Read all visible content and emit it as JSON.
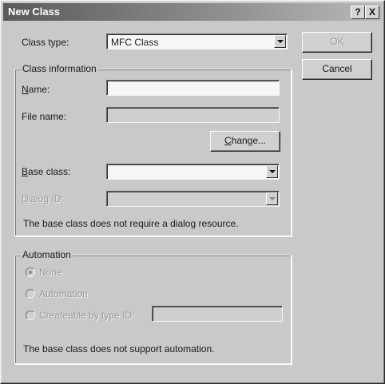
{
  "window": {
    "title": "New Class",
    "help_button": "?",
    "close_button": "X"
  },
  "class_type": {
    "label": "Class type:",
    "value": "MFC Class"
  },
  "buttons": {
    "ok": "OK",
    "cancel": "Cancel",
    "change": "Change..."
  },
  "class_information": {
    "legend": "Class information",
    "name_label": "Name:",
    "name_value": "",
    "file_name_label": "File name:",
    "file_name_value": "",
    "base_class_label": "Base class:",
    "base_class_value": "",
    "dialog_id_label": "Dialog ID:",
    "dialog_id_value": "",
    "note": "The base class does not require a dialog resource."
  },
  "automation": {
    "legend": "Automation",
    "options": [
      {
        "label": "None",
        "checked": true
      },
      {
        "label": "Automation",
        "checked": false
      },
      {
        "label": "Createable by type ID:",
        "checked": false
      }
    ],
    "type_id_value": "",
    "note": "The base class does not support automation."
  }
}
